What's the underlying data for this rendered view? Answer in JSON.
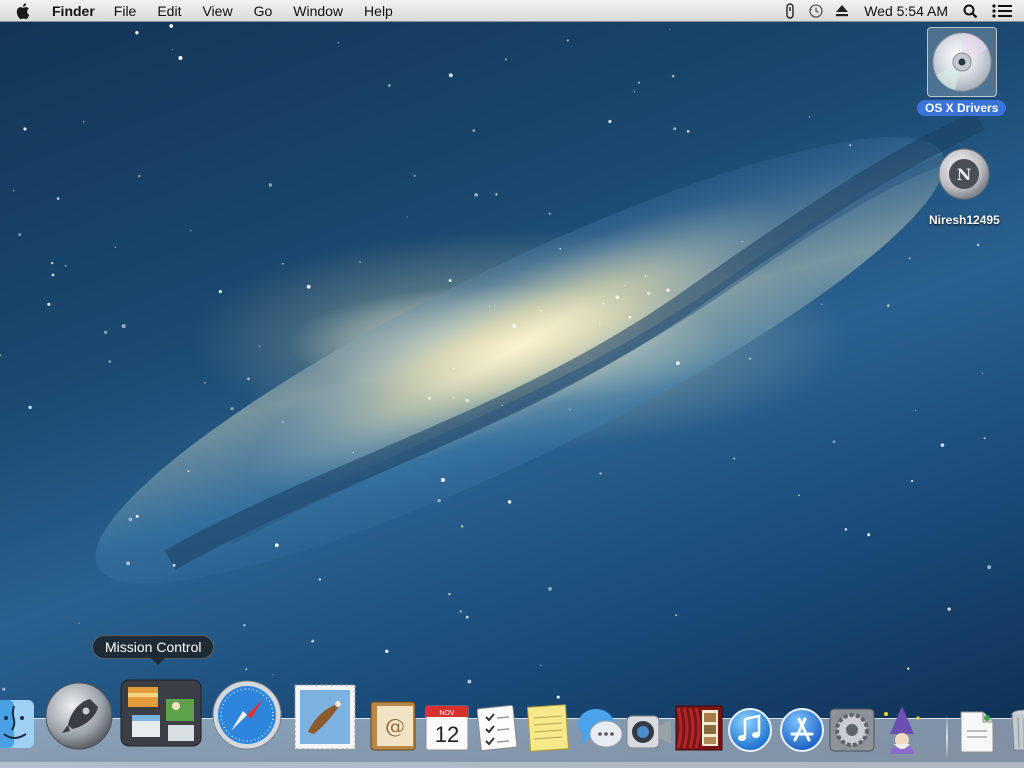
{
  "menubar": {
    "app_name": "Finder",
    "menus": [
      "File",
      "Edit",
      "View",
      "Go",
      "Window",
      "Help"
    ],
    "status_icons": [
      "script-menu-icon",
      "time-machine-icon",
      "eject-icon"
    ],
    "clock": "Wed 5:54 AM",
    "spotlight_icon": "spotlight-search-icon",
    "notification_icon": "notification-center-icon"
  },
  "desktop": {
    "icons": [
      {
        "label": "OS X Drivers",
        "icon": "cd-disc-icon",
        "selected": true
      },
      {
        "label": "Niresh12495",
        "icon": "hard-drive-icon",
        "selected": false
      }
    ]
  },
  "tooltip": {
    "text": "Mission Control"
  },
  "dock": {
    "items": [
      {
        "name": "Finder",
        "icon": "finder-icon"
      },
      {
        "name": "Launchpad",
        "icon": "launchpad-rocket-icon"
      },
      {
        "name": "Mission Control",
        "icon": "mission-control-icon"
      },
      {
        "name": "Safari",
        "icon": "safari-compass-icon"
      },
      {
        "name": "Mail",
        "icon": "mail-stamp-icon"
      },
      {
        "name": "Contacts",
        "icon": "contacts-book-icon"
      },
      {
        "name": "Calendar",
        "icon": "calendar-icon",
        "month": "NOV",
        "day": "12"
      },
      {
        "name": "Reminders",
        "icon": "reminders-icon"
      },
      {
        "name": "Notes",
        "icon": "notes-icon"
      },
      {
        "name": "Messages",
        "icon": "messages-bubble-icon"
      },
      {
        "name": "FaceTime",
        "icon": "facetime-camera-icon"
      },
      {
        "name": "Photo Booth",
        "icon": "photo-booth-icon"
      },
      {
        "name": "iTunes",
        "icon": "itunes-note-icon"
      },
      {
        "name": "App Store",
        "icon": "app-store-icon"
      },
      {
        "name": "System Preferences",
        "icon": "system-preferences-gear-icon"
      },
      {
        "name": "Wizard",
        "icon": "wizard-icon"
      },
      {
        "name": "Document",
        "icon": "document-icon"
      },
      {
        "name": "Trash",
        "icon": "trash-icon"
      }
    ]
  }
}
